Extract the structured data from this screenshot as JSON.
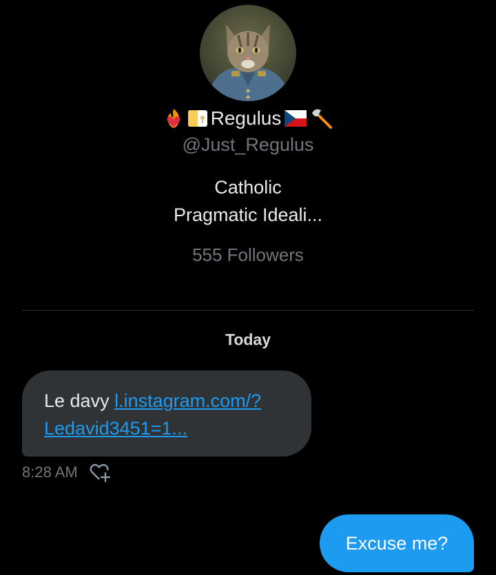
{
  "profile": {
    "avatar_icon": "cat-in-uniform-portrait",
    "display_name": "Regulus",
    "name_emojis_before": [
      "fire-heart-icon",
      "vatican-flag-icon"
    ],
    "name_emojis_after": [
      "czech-flag-icon",
      "axe-icon"
    ],
    "handle": "@Just_Regulus",
    "bio_lines": [
      "Catholic",
      "Pragmatic Ideali..."
    ],
    "followers": "555 Followers"
  },
  "conversation": {
    "day_label": "Today",
    "messages": [
      {
        "direction": "incoming",
        "text_prefix": "Le davy ",
        "link_line1": "l.instagram.com/?",
        "link_line2": "Ledavid3451=1...",
        "time": "8:28 AM",
        "reaction_icon": "heart-plus-icon"
      },
      {
        "direction": "outgoing",
        "text": "Excuse me?"
      }
    ]
  },
  "colors": {
    "background": "#000000",
    "incoming_bubble": "#2f3336",
    "outgoing_bubble": "#1d9bf0",
    "link": "#1d9bf0",
    "secondary_text": "#71767b",
    "primary_text": "#e7e9ea"
  }
}
